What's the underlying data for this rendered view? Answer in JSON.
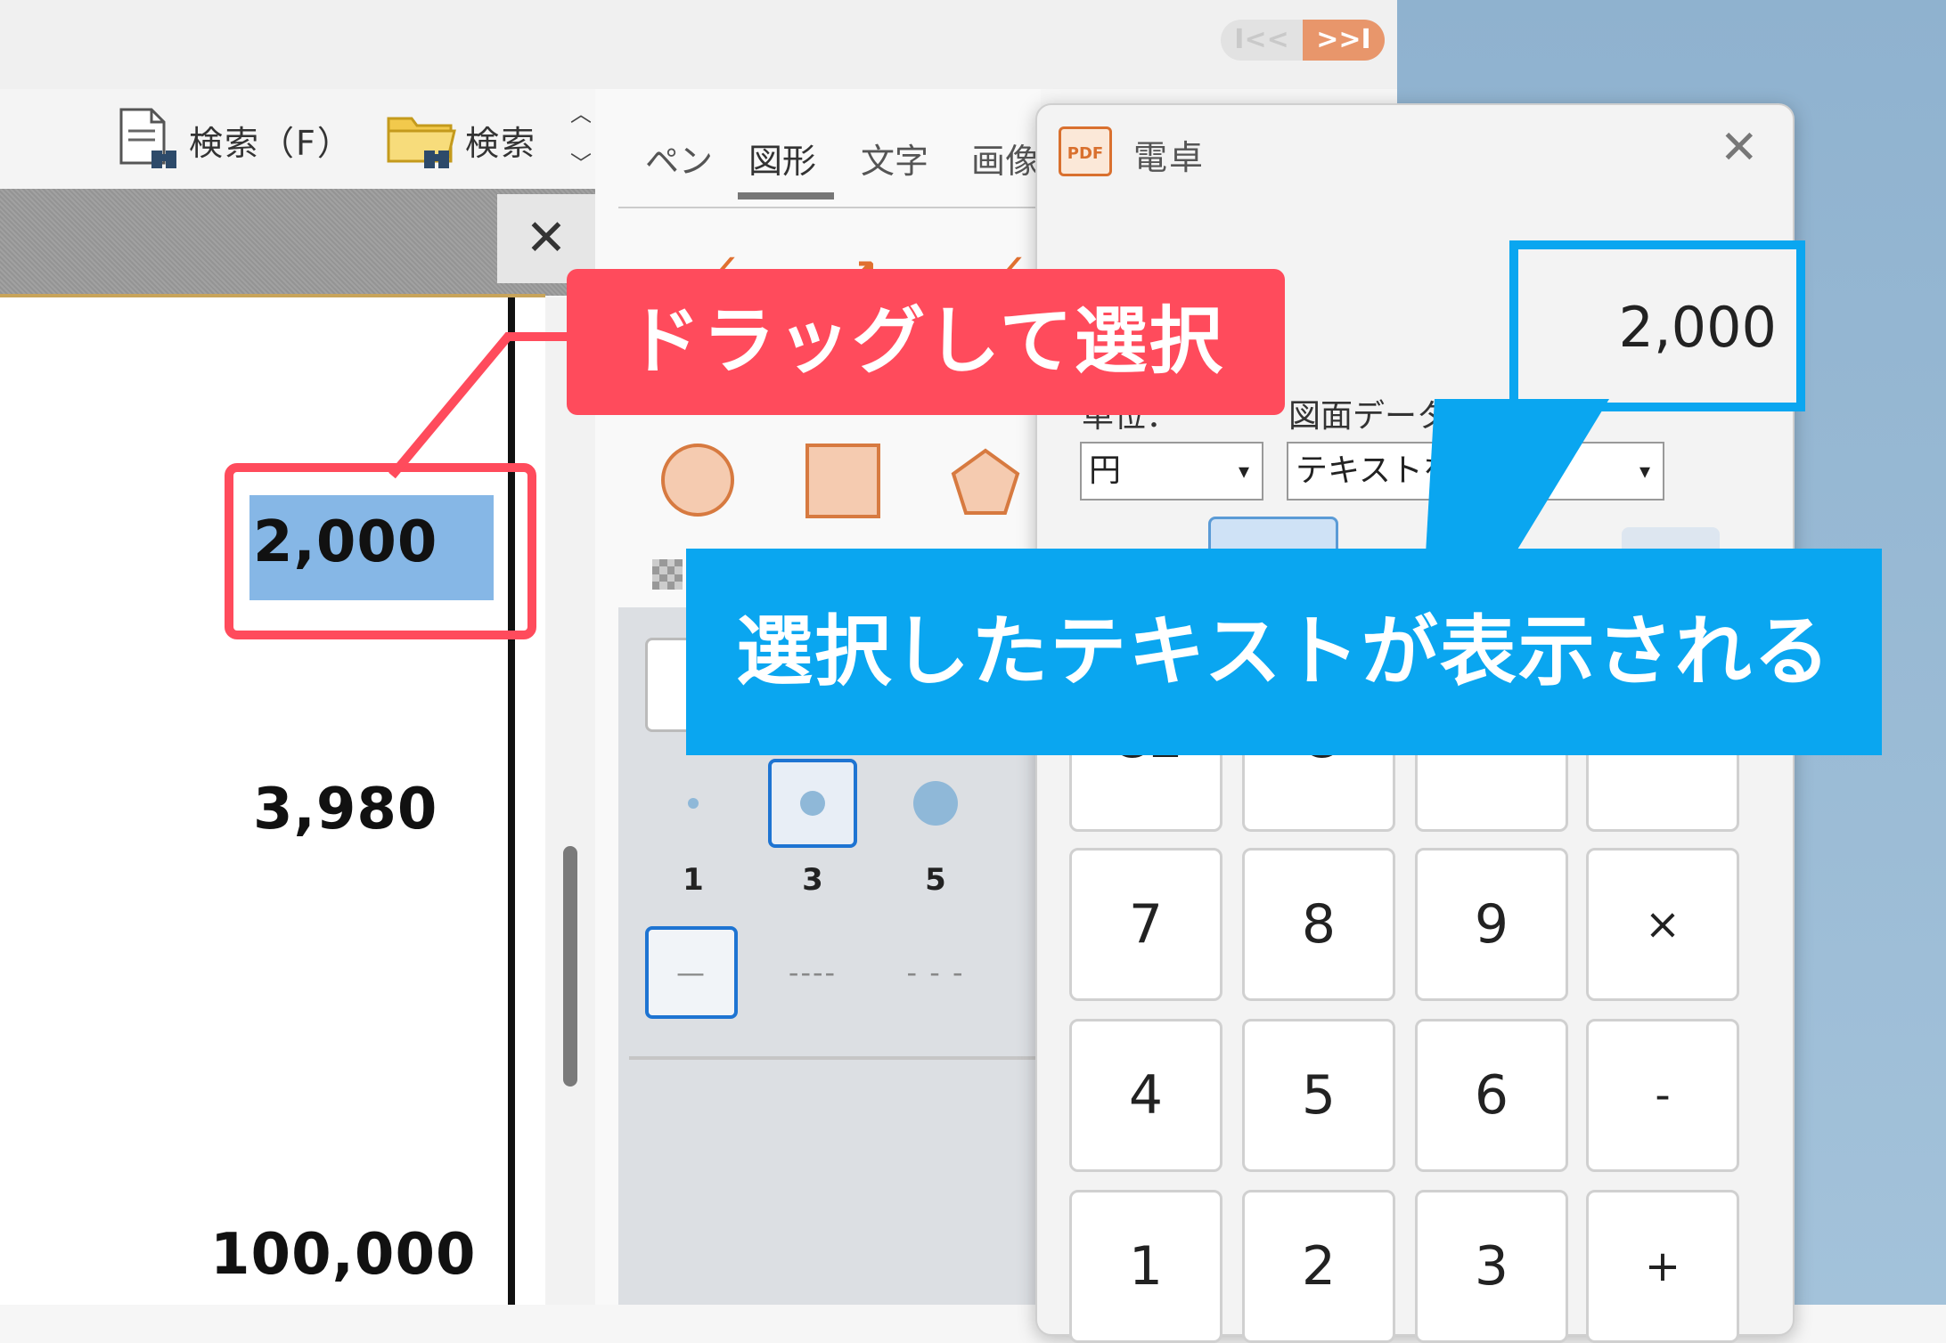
{
  "nav": {
    "prev_glyph": "I<<",
    "next_glyph": ">>I"
  },
  "toolbar": {
    "search_file_label": "検索（F）",
    "search_folder_label": "検索"
  },
  "document": {
    "close_glyph": "✕",
    "values": [
      "2,000",
      "3,980",
      "100,000"
    ]
  },
  "panel": {
    "tabs": [
      "ペン",
      "図形",
      "文字",
      "画像"
    ],
    "active_tab": "図形",
    "dot_sizes": [
      "1",
      "3",
      "5"
    ],
    "line_styles": [
      "—",
      "----",
      "- - -"
    ]
  },
  "calculator": {
    "title": "電卓",
    "icon_text": "PDF",
    "close_glyph": "✕",
    "display_value": "2,000",
    "unit_label": "単位：",
    "unit_value": "円",
    "fetch_label": "図面データの取得：",
    "fetch_value": "テキストを取得",
    "caret": "▾",
    "keys": {
      "ce": "CE",
      "c": "C",
      "back": "⟵",
      "divide": "÷",
      "k7": "7",
      "k8": "8",
      "k9": "9",
      "multiply": "×",
      "k4": "4",
      "k5": "5",
      "k6": "6",
      "minus": "-",
      "k1": "1",
      "k2": "2",
      "k3": "3",
      "plus": "+"
    }
  },
  "callouts": {
    "drag_select": "ドラッグして選択",
    "text_shown": "選択したテキストが表示される"
  },
  "colors": {
    "callout_red": "#ff4b5c",
    "callout_blue": "#0aa6f0",
    "selection_blue": "#86b7e6",
    "shape_orange": "#d77a40"
  }
}
